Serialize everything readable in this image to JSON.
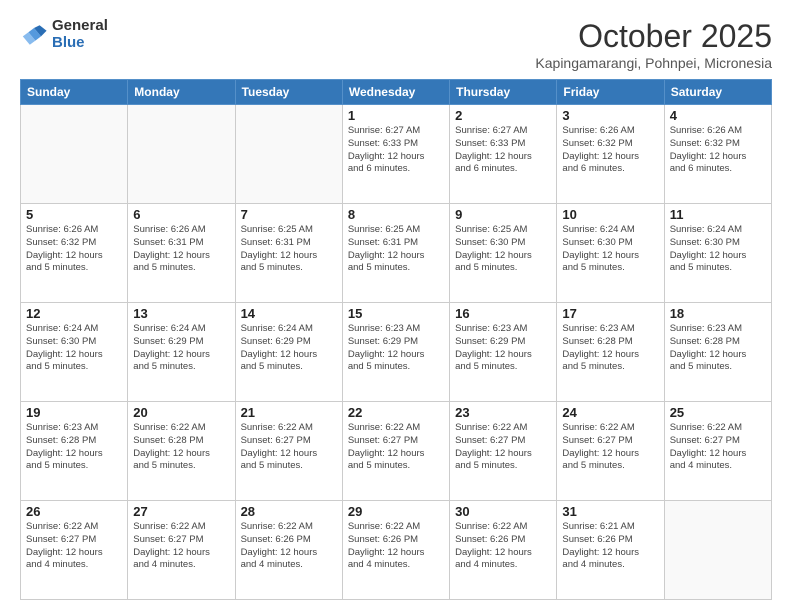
{
  "header": {
    "logo_general": "General",
    "logo_blue": "Blue",
    "month_title": "October 2025",
    "location": "Kapingamarangi, Pohnpei, Micronesia"
  },
  "days_of_week": [
    "Sunday",
    "Monday",
    "Tuesday",
    "Wednesday",
    "Thursday",
    "Friday",
    "Saturday"
  ],
  "weeks": [
    [
      {
        "day": "",
        "info": ""
      },
      {
        "day": "",
        "info": ""
      },
      {
        "day": "",
        "info": ""
      },
      {
        "day": "1",
        "info": "Sunrise: 6:27 AM\nSunset: 6:33 PM\nDaylight: 12 hours\nand 6 minutes."
      },
      {
        "day": "2",
        "info": "Sunrise: 6:27 AM\nSunset: 6:33 PM\nDaylight: 12 hours\nand 6 minutes."
      },
      {
        "day": "3",
        "info": "Sunrise: 6:26 AM\nSunset: 6:32 PM\nDaylight: 12 hours\nand 6 minutes."
      },
      {
        "day": "4",
        "info": "Sunrise: 6:26 AM\nSunset: 6:32 PM\nDaylight: 12 hours\nand 6 minutes."
      }
    ],
    [
      {
        "day": "5",
        "info": "Sunrise: 6:26 AM\nSunset: 6:32 PM\nDaylight: 12 hours\nand 5 minutes."
      },
      {
        "day": "6",
        "info": "Sunrise: 6:26 AM\nSunset: 6:31 PM\nDaylight: 12 hours\nand 5 minutes."
      },
      {
        "day": "7",
        "info": "Sunrise: 6:25 AM\nSunset: 6:31 PM\nDaylight: 12 hours\nand 5 minutes."
      },
      {
        "day": "8",
        "info": "Sunrise: 6:25 AM\nSunset: 6:31 PM\nDaylight: 12 hours\nand 5 minutes."
      },
      {
        "day": "9",
        "info": "Sunrise: 6:25 AM\nSunset: 6:30 PM\nDaylight: 12 hours\nand 5 minutes."
      },
      {
        "day": "10",
        "info": "Sunrise: 6:24 AM\nSunset: 6:30 PM\nDaylight: 12 hours\nand 5 minutes."
      },
      {
        "day": "11",
        "info": "Sunrise: 6:24 AM\nSunset: 6:30 PM\nDaylight: 12 hours\nand 5 minutes."
      }
    ],
    [
      {
        "day": "12",
        "info": "Sunrise: 6:24 AM\nSunset: 6:30 PM\nDaylight: 12 hours\nand 5 minutes."
      },
      {
        "day": "13",
        "info": "Sunrise: 6:24 AM\nSunset: 6:29 PM\nDaylight: 12 hours\nand 5 minutes."
      },
      {
        "day": "14",
        "info": "Sunrise: 6:24 AM\nSunset: 6:29 PM\nDaylight: 12 hours\nand 5 minutes."
      },
      {
        "day": "15",
        "info": "Sunrise: 6:23 AM\nSunset: 6:29 PM\nDaylight: 12 hours\nand 5 minutes."
      },
      {
        "day": "16",
        "info": "Sunrise: 6:23 AM\nSunset: 6:29 PM\nDaylight: 12 hours\nand 5 minutes."
      },
      {
        "day": "17",
        "info": "Sunrise: 6:23 AM\nSunset: 6:28 PM\nDaylight: 12 hours\nand 5 minutes."
      },
      {
        "day": "18",
        "info": "Sunrise: 6:23 AM\nSunset: 6:28 PM\nDaylight: 12 hours\nand 5 minutes."
      }
    ],
    [
      {
        "day": "19",
        "info": "Sunrise: 6:23 AM\nSunset: 6:28 PM\nDaylight: 12 hours\nand 5 minutes."
      },
      {
        "day": "20",
        "info": "Sunrise: 6:22 AM\nSunset: 6:28 PM\nDaylight: 12 hours\nand 5 minutes."
      },
      {
        "day": "21",
        "info": "Sunrise: 6:22 AM\nSunset: 6:27 PM\nDaylight: 12 hours\nand 5 minutes."
      },
      {
        "day": "22",
        "info": "Sunrise: 6:22 AM\nSunset: 6:27 PM\nDaylight: 12 hours\nand 5 minutes."
      },
      {
        "day": "23",
        "info": "Sunrise: 6:22 AM\nSunset: 6:27 PM\nDaylight: 12 hours\nand 5 minutes."
      },
      {
        "day": "24",
        "info": "Sunrise: 6:22 AM\nSunset: 6:27 PM\nDaylight: 12 hours\nand 5 minutes."
      },
      {
        "day": "25",
        "info": "Sunrise: 6:22 AM\nSunset: 6:27 PM\nDaylight: 12 hours\nand 4 minutes."
      }
    ],
    [
      {
        "day": "26",
        "info": "Sunrise: 6:22 AM\nSunset: 6:27 PM\nDaylight: 12 hours\nand 4 minutes."
      },
      {
        "day": "27",
        "info": "Sunrise: 6:22 AM\nSunset: 6:27 PM\nDaylight: 12 hours\nand 4 minutes."
      },
      {
        "day": "28",
        "info": "Sunrise: 6:22 AM\nSunset: 6:26 PM\nDaylight: 12 hours\nand 4 minutes."
      },
      {
        "day": "29",
        "info": "Sunrise: 6:22 AM\nSunset: 6:26 PM\nDaylight: 12 hours\nand 4 minutes."
      },
      {
        "day": "30",
        "info": "Sunrise: 6:22 AM\nSunset: 6:26 PM\nDaylight: 12 hours\nand 4 minutes."
      },
      {
        "day": "31",
        "info": "Sunrise: 6:21 AM\nSunset: 6:26 PM\nDaylight: 12 hours\nand 4 minutes."
      },
      {
        "day": "",
        "info": ""
      }
    ]
  ]
}
